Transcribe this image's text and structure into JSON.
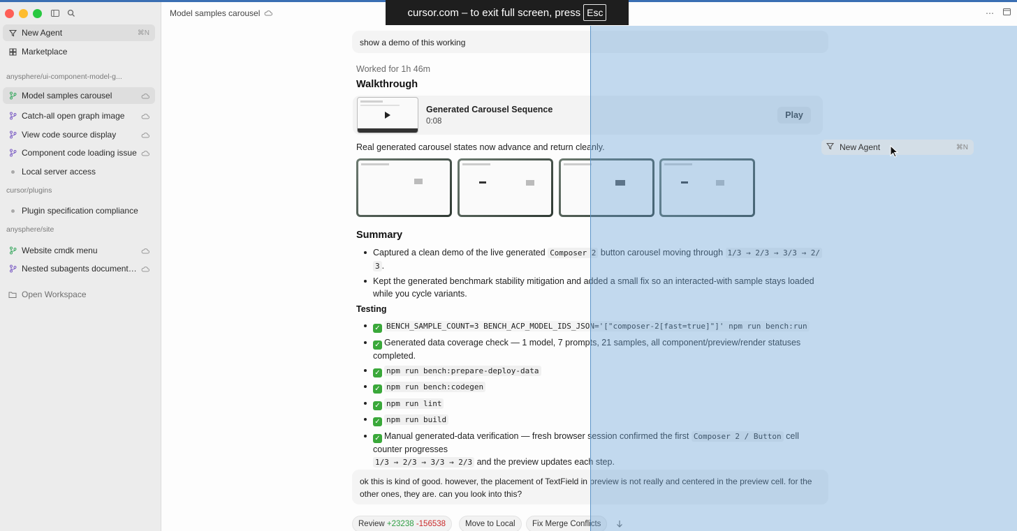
{
  "banner": {
    "text": "cursor.com – to exit full screen, press",
    "key": "Esc"
  },
  "header": {
    "title": "Model samples carousel"
  },
  "sidebar": {
    "new_agent": {
      "label": "New Agent",
      "shortcut": "⌘N"
    },
    "marketplace": "Marketplace",
    "groups": [
      {
        "name": "anysphere/ui-component-model-g...",
        "items": [
          {
            "label": "Model samples carousel",
            "kind": "branch",
            "cloud": true,
            "active": true
          },
          {
            "label": "Catch-all open graph image",
            "kind": "branch",
            "cloud": true
          },
          {
            "label": "View code source display",
            "kind": "branch",
            "cloud": true
          },
          {
            "label": "Component code loading issue",
            "kind": "branch",
            "cloud": true
          },
          {
            "label": "Local server access",
            "kind": "dot",
            "cloud": false
          }
        ]
      },
      {
        "name": "cursor/plugins",
        "items": [
          {
            "label": "Plugin specification compliance",
            "kind": "dot",
            "cloud": false
          }
        ]
      },
      {
        "name": "anysphere/site",
        "items": [
          {
            "label": "Website cmdk menu",
            "kind": "branch",
            "cloud": true
          },
          {
            "label": "Nested subagents documenta...",
            "kind": "branch",
            "cloud": true
          }
        ]
      }
    ],
    "open_workspace": "Open Workspace"
  },
  "chat": {
    "user_message_1": "show a demo of this working",
    "worked_for": "Worked for 1h 46m",
    "walkthrough_heading": "Walkthrough",
    "video": {
      "title": "Generated Carousel Sequence",
      "duration": "0:08",
      "play_label": "Play"
    },
    "carousel_caption": "Real generated carousel states now advance and return cleanly.",
    "summary_heading": "Summary",
    "summary": {
      "b1_pre": "Captured a clean demo of the live generated",
      "b1_code1": "Composer 2",
      "b1_mid": "button carousel moving through",
      "b1_code2a": "1/3 → 2/3 → 3/3 → 2/",
      "b1_code2b": "3",
      "b1_end": ".",
      "b2": "Kept the generated benchmark stability mitigation and added a small fix so an interacted-with sample stays loaded while you cycle variants."
    },
    "testing_heading": "Testing",
    "testing": {
      "t1_code": "BENCH_SAMPLE_COUNT=3 BENCH_ACP_MODEL_IDS_JSON='[\"composer-2[fast=true]\"]' npm run bench:run",
      "t2": "Generated data coverage check — 1 model, 7 prompts, 21 samples, all component/preview/render statuses completed.",
      "t3_code": "npm run bench:prepare-deploy-data",
      "t4_code": "npm run bench:codegen",
      "t5_code": "npm run lint",
      "t6_code": "npm run build",
      "t7_pre": "Manual generated-data verification — fresh browser session confirmed the first",
      "t7_code1": "Composer 2 / Button",
      "t7_mid": "cell counter progresses",
      "t7_code2": "1/3 → 2/3 → 3/3 → 2/3",
      "t7_end": "and the preview updates each step."
    },
    "user_message_2": "ok this is kind of good. however, the placement of TextField in preview is not really and centered in the preview cell. for the other ones, they are. can you look into this?",
    "actions": {
      "review_label": "Review",
      "review_added": "+23238",
      "review_removed": "-156538",
      "move_local": "Move to Local",
      "fix_merge": "Fix Merge Conflicts"
    }
  },
  "drag_ghost": {
    "label": "New Agent",
    "shortcut": "⌘N"
  },
  "colors": {
    "accent_blue": "#3a6fb3",
    "overlay": "#68a3d8",
    "added": "#2f9e44",
    "removed": "#c92a2a"
  }
}
